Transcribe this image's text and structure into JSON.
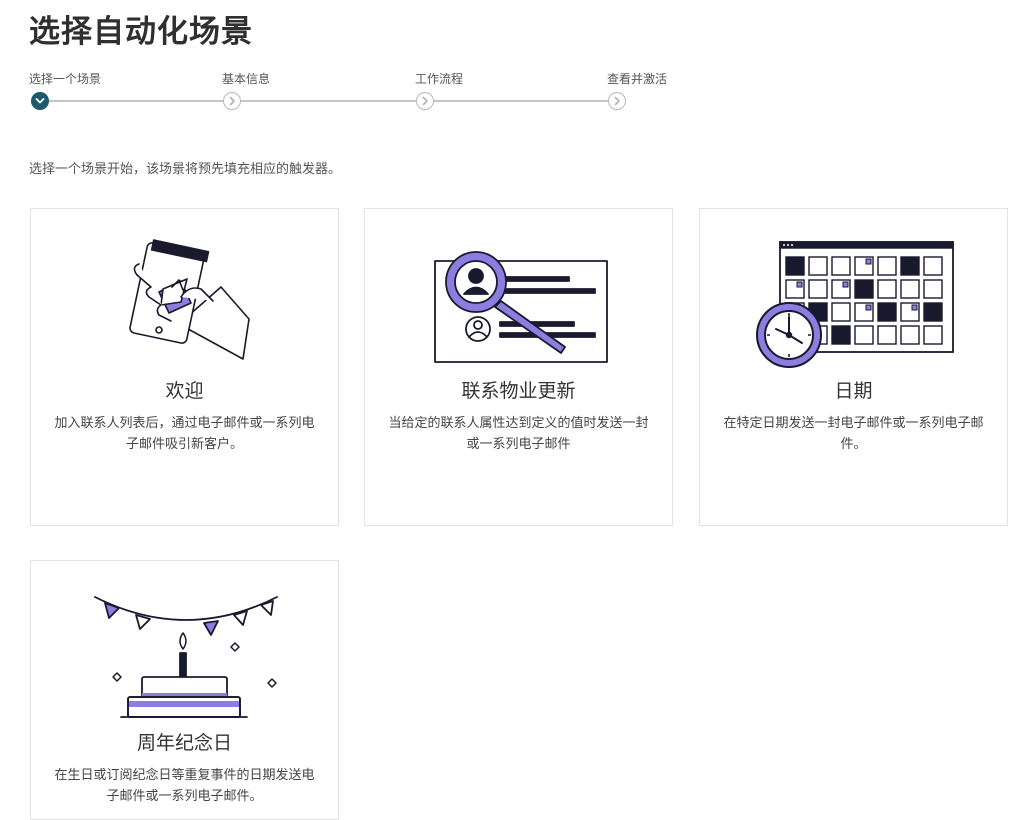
{
  "page": {
    "title": "选择自动化场景",
    "intro": "选择一个场景开始，该场景将预先填充相应的触发器。"
  },
  "stepper": {
    "steps": [
      {
        "label": "选择一个场景",
        "state": "active"
      },
      {
        "label": "基本信息",
        "state": "pending"
      },
      {
        "label": "工作流程",
        "state": "pending"
      },
      {
        "label": "查看并激活",
        "state": "pending"
      }
    ]
  },
  "cards": [
    {
      "title": "欢迎",
      "description": "加入联系人列表后，通过电子邮件或一系列电子邮件吸引新客户。",
      "icon": "phone-hand-icon"
    },
    {
      "title": "联系物业更新",
      "description": "当给定的联系人属性达到定义的值时发送一封或一系列电子邮件",
      "icon": "contact-magnifier-icon"
    },
    {
      "title": "日期",
      "description": "在特定日期发送一封电子邮件或一系列电子邮件。",
      "icon": "calendar-clock-icon"
    },
    {
      "title": "周年纪念日",
      "description": "在生日或订阅纪念日等重复事件的日期发送电子邮件或一系列电子邮件。",
      "icon": "birthday-cake-icon"
    }
  ],
  "colors": {
    "accent_purple": "#8b7ee0",
    "step_active": "#1e5a6b",
    "ink": "#1a1a2e"
  }
}
